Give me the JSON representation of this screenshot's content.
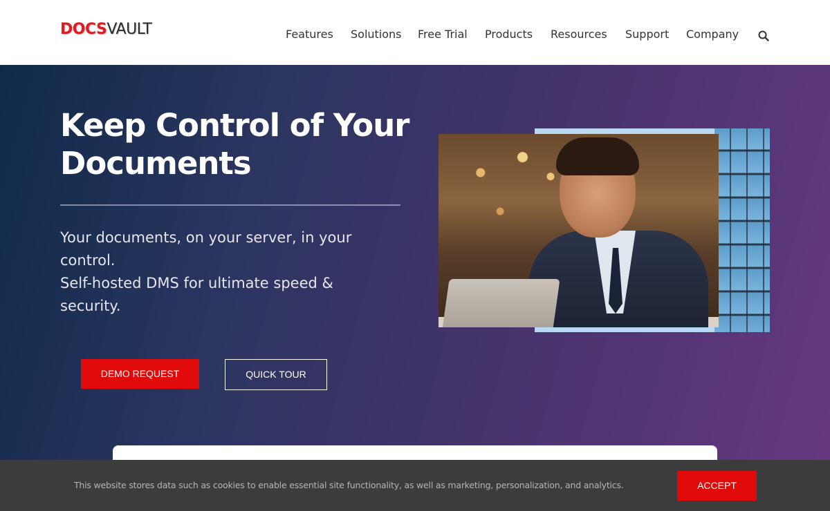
{
  "header": {
    "logo": {
      "part1": "DOCS",
      "part2": "VAULT"
    },
    "nav": [
      {
        "label": "Features"
      },
      {
        "label": "Solutions"
      },
      {
        "label": "Free Trial"
      },
      {
        "label": "Products"
      },
      {
        "label": "Resources"
      },
      {
        "label": "Support"
      },
      {
        "label": "Company"
      }
    ],
    "search_icon": "search-icon"
  },
  "hero": {
    "title": "Keep Control of Your Documents",
    "subtitle_line1": "Your documents, on your server, in your control.",
    "subtitle_line2": "Self-hosted DMS for ultimate speed & security.",
    "demo_button": "DEMO REQUEST",
    "tour_button": "QUICK TOUR"
  },
  "cookie_bar": {
    "text": "This website stores data such as cookies to enable essential site functionality, as well as marketing, personalization, and analytics.",
    "accept_button": "ACCEPT"
  },
  "colors": {
    "brand_red": "#e01b22",
    "button_red": "#e00a0a",
    "cookie_bg": "#3c3c3c"
  }
}
